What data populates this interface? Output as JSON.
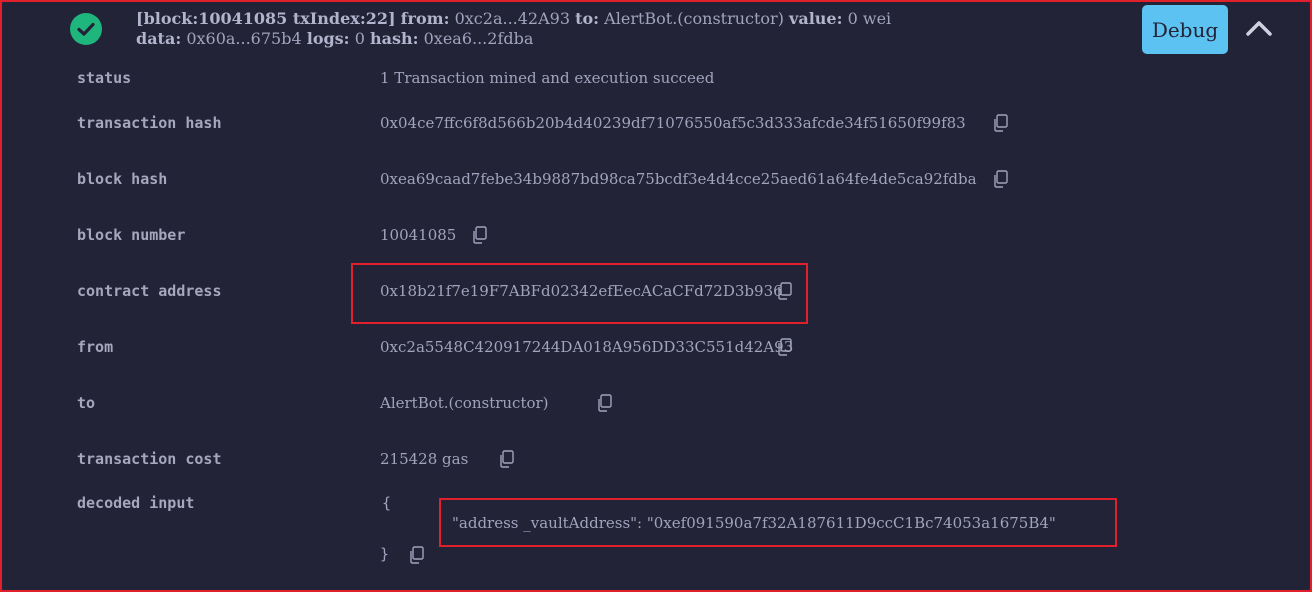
{
  "header": {
    "block_label": "[block:10041085 txIndex:22]",
    "from_label": "from:",
    "from_value": "0xc2a...42A93",
    "to_label": "to:",
    "to_value": "AlertBot.(constructor)",
    "value_label": "value:",
    "value_value": "0 wei",
    "data_label": "data:",
    "data_value": "0x60a...675b4",
    "logs_label": "logs:",
    "logs_value": "0",
    "hash_label": "hash:",
    "hash_value": "0xea6...2fdba",
    "debug_label": "Debug",
    "status_icon": "check-circle-icon",
    "collapse_icon": "chevron-up-icon"
  },
  "rows": [
    {
      "label": "status",
      "value": "1 Transaction mined and execution succeed"
    },
    {
      "label": "transaction hash",
      "value": "0x04ce7ffc6f8d566b20b4d40239df71076550af5c3d333afcde34f51650f99f83"
    },
    {
      "label": "block hash",
      "value": "0xea69caad7febe34b9887bd98ca75bcdf3e4d4cce25aed61a64fe4de5ca92fdba"
    },
    {
      "label": "block number",
      "value": "10041085"
    },
    {
      "label": "contract address",
      "value": "0x18b21f7e19F7ABFd02342efEecACaCFd72D3b936"
    },
    {
      "label": "from",
      "value": "0xc2a5548C420917244DA018A956DD33C551d42A93"
    },
    {
      "label": "to",
      "value": "AlertBot.(constructor)"
    },
    {
      "label": "transaction cost",
      "value": "215428 gas"
    },
    {
      "label": "decoded input",
      "value": "{"
    }
  ],
  "decoded_input": {
    "open_brace": "{",
    "line": "\"address _vaultAddress\": \"0xef091590a7f32A187611D9ccC1Bc74053a1675B4\"",
    "close_brace": "}"
  },
  "colors": {
    "background": "#222336",
    "text": "#a2a3bd",
    "success": "#1fb67e",
    "debug_button": "#5cc2f2",
    "highlight_box": "#e0202a"
  }
}
